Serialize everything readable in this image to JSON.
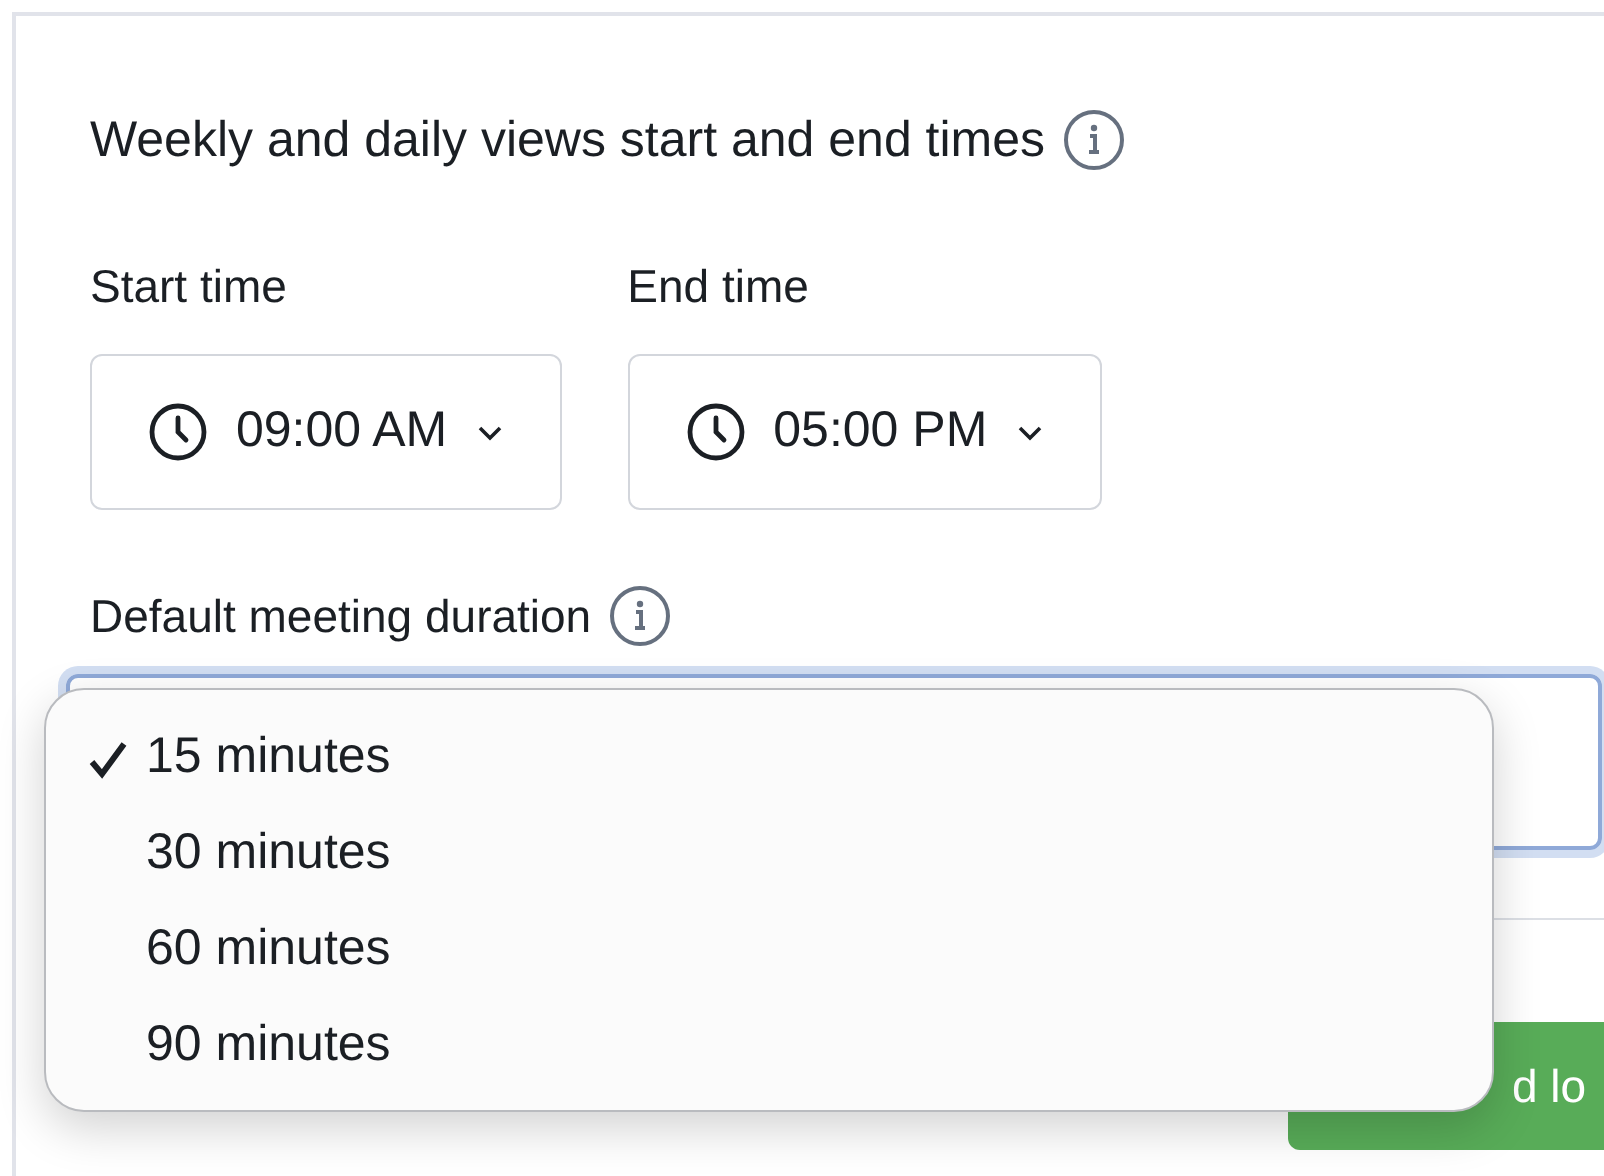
{
  "section": {
    "title": "Weekly and daily views start and end times"
  },
  "start_time": {
    "label": "Start time",
    "value": "09:00 AM"
  },
  "end_time": {
    "label": "End time",
    "value": "05:00 PM"
  },
  "duration": {
    "label": "Default meeting duration",
    "focused": true
  },
  "duration_menu": [
    {
      "label": "15 minutes",
      "selected": true
    },
    {
      "label": "30 minutes",
      "selected": false
    },
    {
      "label": "60 minutes",
      "selected": false
    },
    {
      "label": "90 minutes",
      "selected": false
    }
  ],
  "footer_button": {
    "label": "d lo"
  }
}
